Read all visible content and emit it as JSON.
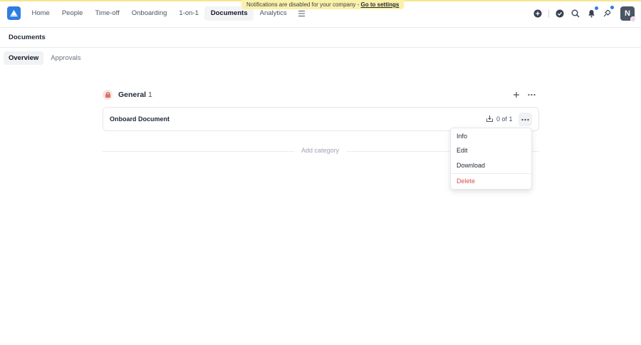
{
  "notice": {
    "text": "Notifications are disabled for your company -",
    "link": "Go to settings"
  },
  "nav": {
    "items": [
      {
        "label": "Home",
        "active": false
      },
      {
        "label": "People",
        "active": false
      },
      {
        "label": "Time-off",
        "active": false
      },
      {
        "label": "Onboarding",
        "active": false
      },
      {
        "label": "1-on-1",
        "active": false
      },
      {
        "label": "Documents",
        "active": true
      },
      {
        "label": "Analytics",
        "active": false
      }
    ],
    "more_icon": "menu-lines-icon"
  },
  "header_icons": [
    "plus-circle-icon",
    "check-circle-icon",
    "search-icon",
    "bell-icon",
    "rocket-icon"
  ],
  "avatar": {
    "initial": "N"
  },
  "page": {
    "title": "Documents"
  },
  "tabs": [
    {
      "label": "Overview",
      "active": true
    },
    {
      "label": "Approvals",
      "active": false
    }
  ],
  "category": {
    "name": "General",
    "count": "1",
    "icon": "category-emoji-icon"
  },
  "document": {
    "name": "Onboard Document",
    "progress": "0 of 1"
  },
  "add_category": {
    "label": "Add category"
  },
  "context_menu": {
    "items": [
      {
        "label": "Info",
        "danger": false
      },
      {
        "label": "Edit",
        "danger": false
      },
      {
        "label": "Download",
        "danger": false
      },
      {
        "label": "Delete",
        "danger": true
      }
    ]
  },
  "colors": {
    "accent": "#2f7de1",
    "notice_bg": "#fbf1a9",
    "danger": "#dc4c4c"
  }
}
